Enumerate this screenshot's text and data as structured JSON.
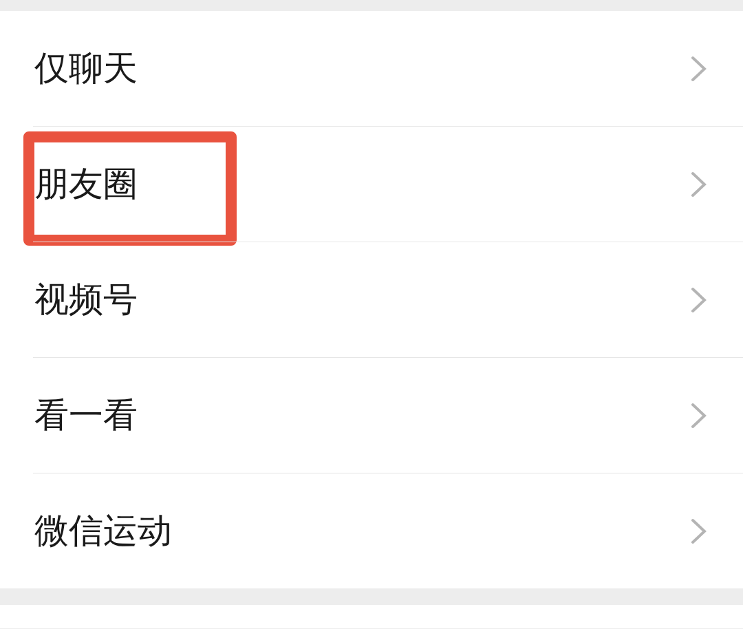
{
  "items": [
    {
      "label": "仅聊天",
      "highlighted": false
    },
    {
      "label": "朋友圈",
      "highlighted": true
    },
    {
      "label": "视频号",
      "highlighted": false
    },
    {
      "label": "看一看",
      "highlighted": false
    },
    {
      "label": "微信运动",
      "highlighted": false
    }
  ]
}
